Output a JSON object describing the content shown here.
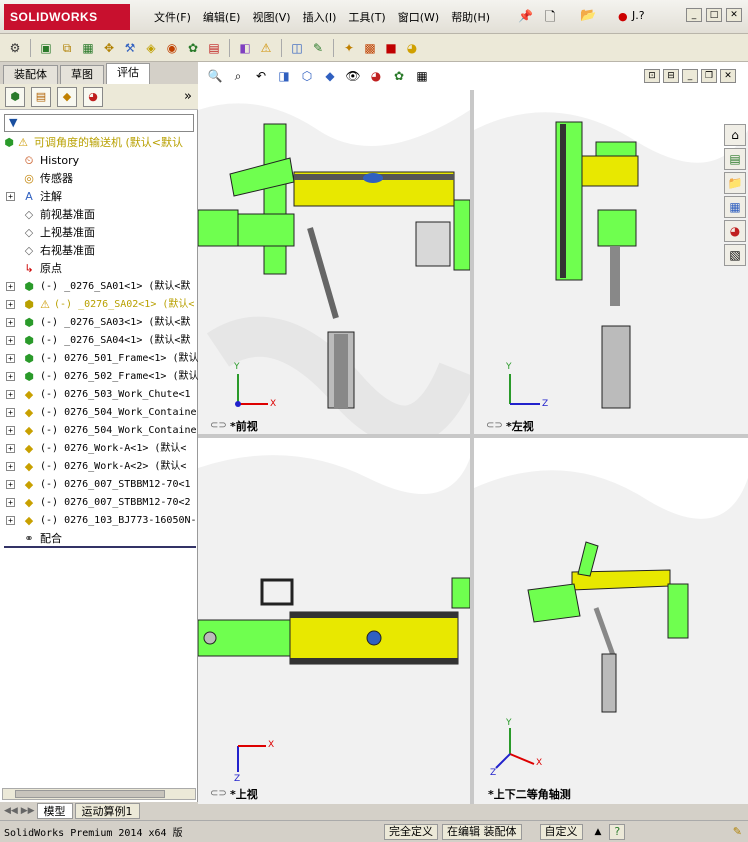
{
  "app": {
    "logo": "SOLIDWORKS",
    "user": "J.?"
  },
  "menu": [
    "文件(F)",
    "编辑(E)",
    "视图(V)",
    "插入(I)",
    "工具(T)",
    "窗口(W)",
    "帮助(H)"
  ],
  "panel": {
    "tabs": [
      "装配体",
      "草图",
      "评估"
    ],
    "filter_icon": "filter-icon",
    "root": "可调角度的输送机 (默认<默认",
    "items": [
      {
        "label": "History",
        "icon": "history-icon"
      },
      {
        "label": "传感器",
        "icon": "sensor-icon"
      },
      {
        "label": "注解",
        "icon": "annotation-icon"
      },
      {
        "label": "前视基准面",
        "icon": "plane-icon"
      },
      {
        "label": "上视基准面",
        "icon": "plane-icon"
      },
      {
        "label": "右视基准面",
        "icon": "plane-icon"
      },
      {
        "label": "原点",
        "icon": "origin-icon"
      },
      {
        "label": "(-) _0276_SA01<1> (默认<默",
        "icon": "assembly-icon"
      },
      {
        "label": "(-) _0276_SA02<1> (默认<",
        "icon": "assembly-warn-icon"
      },
      {
        "label": "(-) _0276_SA03<1> (默认<默",
        "icon": "assembly-icon"
      },
      {
        "label": "(-) _0276_SA04<1> (默认<默",
        "icon": "assembly-icon"
      },
      {
        "label": "(-) 0276_501_Frame<1> (默认",
        "icon": "assembly-icon"
      },
      {
        "label": "(-) 0276_502_Frame<1> (默认",
        "icon": "assembly-icon"
      },
      {
        "label": "(-) 0276_503_Work_Chute<1",
        "icon": "part-icon"
      },
      {
        "label": "(-) 0276_504_Work_Containe",
        "icon": "part-icon"
      },
      {
        "label": "(-) 0276_504_Work_Containe",
        "icon": "part-icon"
      },
      {
        "label": "(-) 0276_Work-A<1> (默认<",
        "icon": "part-icon"
      },
      {
        "label": "(-) 0276_Work-A<2> (默认<",
        "icon": "part-icon"
      },
      {
        "label": "(-) 0276_007_STBBM12-70<1",
        "icon": "part-icon"
      },
      {
        "label": "(-) 0276_007_STBBM12-70<2",
        "icon": "part-icon"
      },
      {
        "label": "(-) 0276_103_BJ773-16050N-",
        "icon": "part-icon"
      },
      {
        "label": "配合",
        "icon": "mates-icon"
      }
    ],
    "bottom_tabs": [
      "模型",
      "运动算例1"
    ]
  },
  "views": {
    "front": "*前视",
    "left": "*左视",
    "top": "*上视",
    "iso": "*上下二等角轴测"
  },
  "axes": {
    "x": "X",
    "y": "Y",
    "z": "Z"
  },
  "status": {
    "app": "SolidWorks Premium 2014 x64 版",
    "def": "完全定义",
    "edit": "在编辑 装配体",
    "custom": "自定义"
  },
  "colors": {
    "green": "#6fff4f",
    "yellow": "#e8e800",
    "accent": "#c8102e"
  }
}
